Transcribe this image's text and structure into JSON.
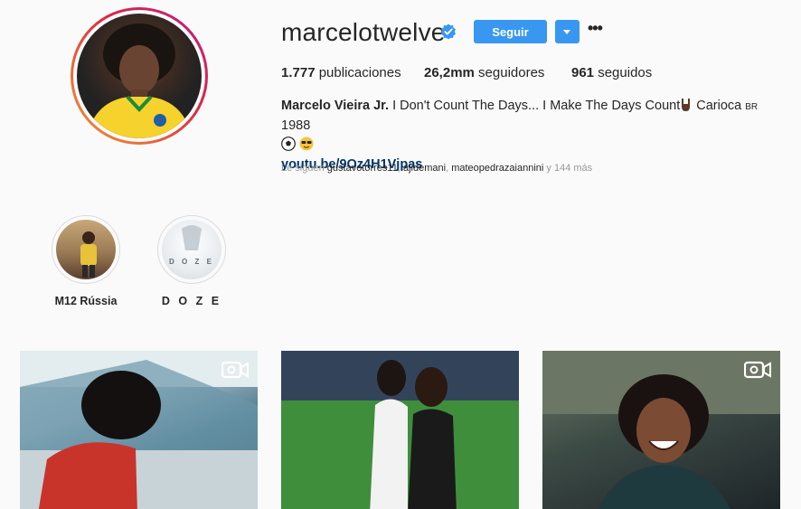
{
  "profile": {
    "username": "marcelotwelve",
    "verified": true,
    "follow_label": "Seguir",
    "stats": {
      "posts_count": "1.777",
      "posts_label": "publicaciones",
      "followers_count": "26,2mm",
      "followers_label": "seguidores",
      "following_count": "961",
      "following_label": "seguidos"
    },
    "bio": {
      "full_name": "Marcelo Vieira Jr.",
      "text": "I Don't Count The Days... I Make The Days Count",
      "text_after_emoji": "Carioca",
      "flag_letters": "BR",
      "year": "1988",
      "link": "youtu.be/9Oz4H1Vjpas"
    },
    "followed_by": {
      "prefix": "Le siguen",
      "users": [
        "gustavotorres11",
        "ajidemani",
        "mateopedrazaiannini"
      ],
      "suffix": "y 144 más"
    }
  },
  "highlights": [
    {
      "label": "M12 Rússia"
    },
    {
      "label": "D O Z E",
      "cover_text": "D O Z E"
    }
  ],
  "posts": [
    {
      "type": "video",
      "icon": "video-camera-icon"
    },
    {
      "type": "photo"
    },
    {
      "type": "video",
      "icon": "video-camera-icon"
    }
  ],
  "colors": {
    "accent": "#3897f0",
    "link": "#003569",
    "verified": "#3897f0",
    "muted": "#999999"
  }
}
